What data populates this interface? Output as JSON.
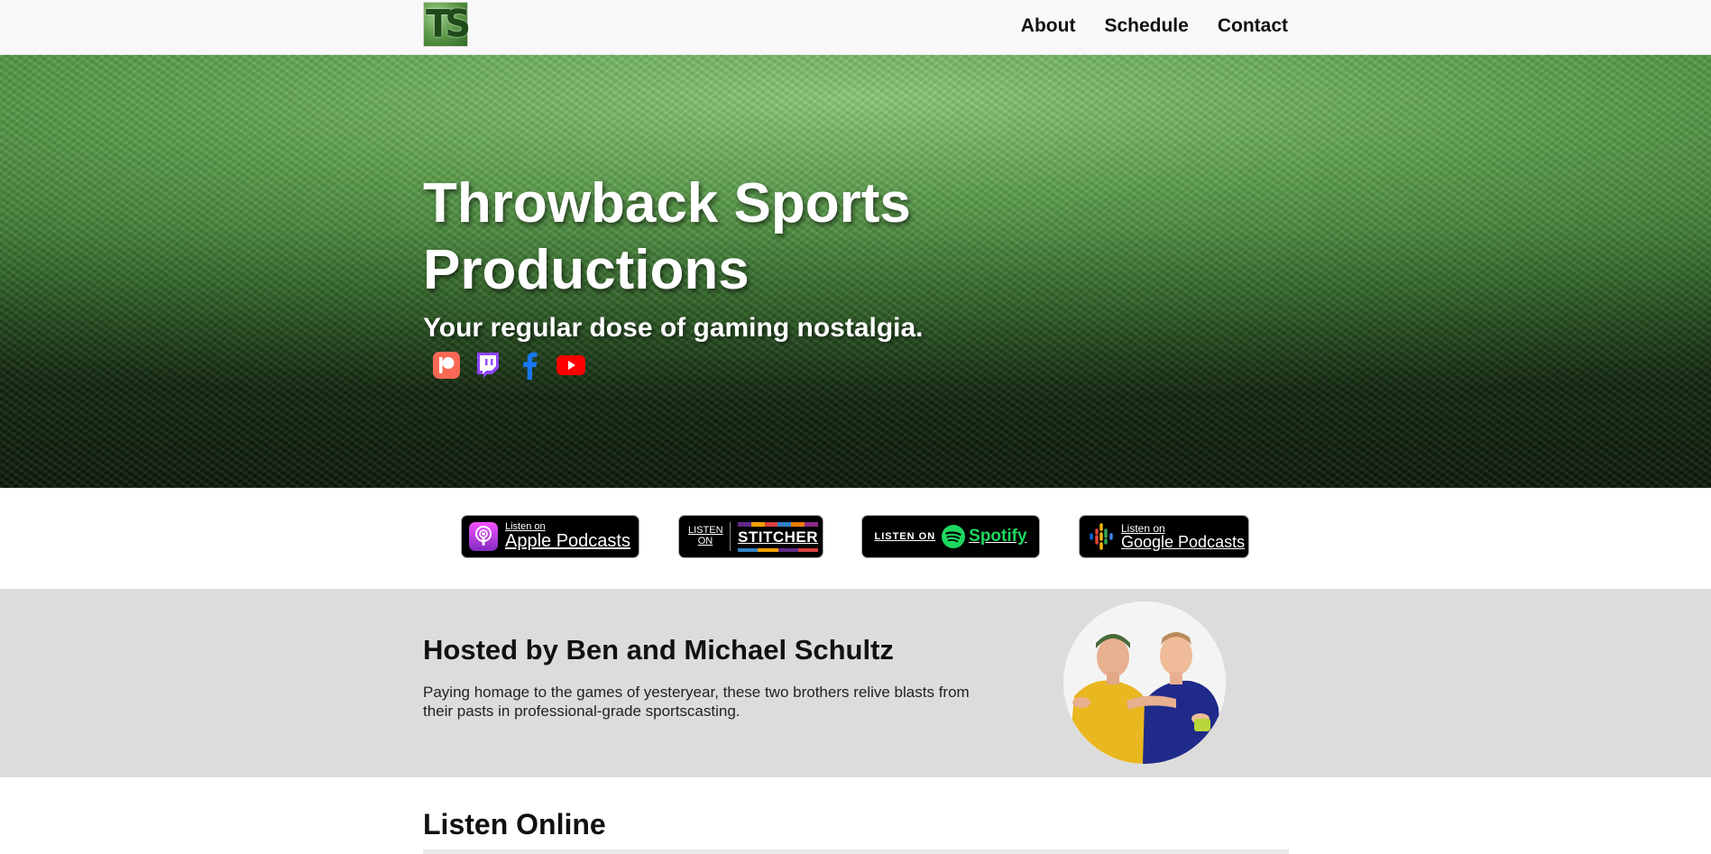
{
  "navbar": {
    "logo_text": "TS",
    "links": [
      "About",
      "Schedule",
      "Contact"
    ]
  },
  "hero": {
    "title": "Throwback Sports Productions",
    "subtitle": "Your regular dose of gaming nostalgia.",
    "social_icons": [
      "patreon-icon",
      "twitch-icon",
      "facebook-icon",
      "youtube-icon"
    ]
  },
  "badges": {
    "apple": {
      "small": "Listen on",
      "big": "Apple Podcasts"
    },
    "stitcher": {
      "small_1": "LISTEN",
      "small_2": "ON",
      "big": "STITCHER"
    },
    "spotify": {
      "small": "LISTEN ON",
      "big": "Spotify"
    },
    "google": {
      "small": "Listen on",
      "big": "Google Podcasts"
    }
  },
  "hosts": {
    "title": "Hosted by Ben and Michael Schultz",
    "description": "Paying homage to the games of yesteryear, these two brothers relive blasts from their pasts in professional-grade sportscasting."
  },
  "listen_online": {
    "title": "Listen Online"
  },
  "colors": {
    "patreon": "#f96854",
    "twitch": "#9146ff",
    "facebook": "#1877f2",
    "youtube": "#ff0000",
    "spotify": "#1ed760",
    "hosts_bg": "#dcdcdc"
  }
}
